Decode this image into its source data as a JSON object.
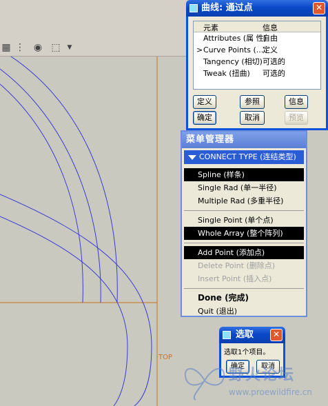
{
  "curve_window": {
    "title": "曲线: 通过点",
    "close": "✕",
    "columns": [
      "元素",
      "信息"
    ],
    "rows": [
      {
        "marker": "",
        "element": "Attributes (属 性)",
        "info": "自由"
      },
      {
        "marker": ">",
        "element": "Curve Points (...",
        "info": "定义"
      },
      {
        "marker": "",
        "element": "Tangency (相切)",
        "info": "可选的"
      },
      {
        "marker": "",
        "element": "Tweak (扭曲)",
        "info": "可选的"
      }
    ],
    "buttons": {
      "define": "定义",
      "refs": "参照",
      "info": "信息",
      "ok": "确定",
      "cancel": "取消",
      "preview": "预览"
    }
  },
  "menu_manager": {
    "title": "菜单管理器",
    "header": "CONNECT TYPE (连结类型)",
    "items": [
      {
        "label": "Spline (样条)",
        "state": "selected"
      },
      {
        "label": "Single Rad (单一半径)",
        "state": "normal"
      },
      {
        "label": "Multiple Rad (多重半径)",
        "state": "normal"
      },
      {
        "label": "Single Point (单个点)",
        "state": "normal"
      },
      {
        "label": "Whole Array (整个阵列)",
        "state": "selected"
      },
      {
        "label": "Add Point (添加点)",
        "state": "selected"
      },
      {
        "label": "Delete Point (删除点)",
        "state": "disabled"
      },
      {
        "label": "Insert Point (插入点)",
        "state": "disabled"
      },
      {
        "label": "Done (完成)",
        "state": "bold"
      },
      {
        "label": "Quit (退出)",
        "state": "normal"
      }
    ]
  },
  "select_window": {
    "title": "选取",
    "close": "✕",
    "message": "选取1个项目。",
    "ok": "确定",
    "cancel": "取消"
  },
  "canvas": {
    "datum_label": "TOP"
  },
  "toolbar": {
    "icons": [
      "layer-icon",
      "tree-icon",
      "binoculars-icon",
      "select-box-icon",
      "dropdown-arrow-icon"
    ]
  },
  "watermark": {
    "text": "野火论坛",
    "url": "www.proewildfire.cn"
  },
  "colors": {
    "xp_title": "#0b49c9",
    "selected_bg": "#000000",
    "curve": "#3a3ad8",
    "datum": "#c8741a"
  }
}
